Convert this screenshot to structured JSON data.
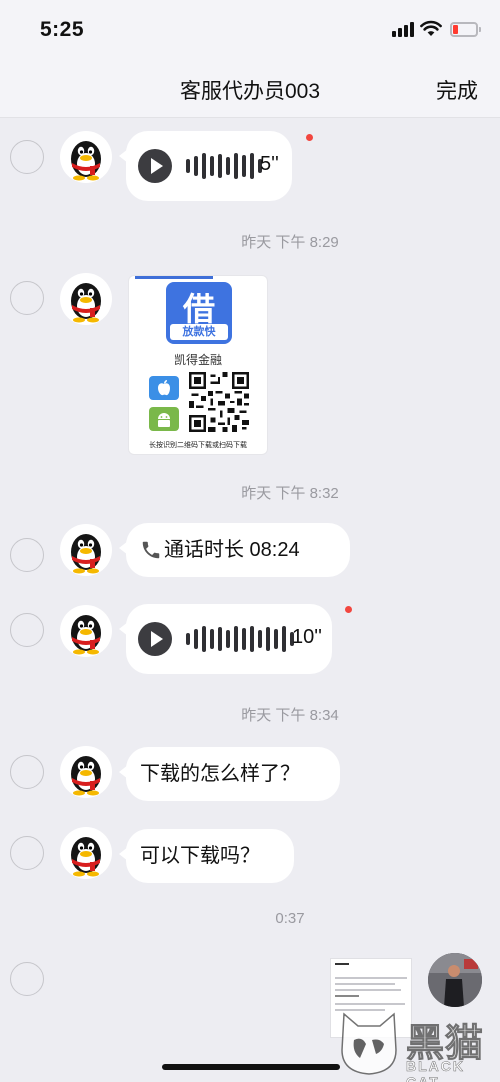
{
  "status_bar": {
    "time": "5:25"
  },
  "nav": {
    "title": "客服代办员003",
    "done_label": "完成"
  },
  "messages": [
    {
      "type": "voice",
      "duration": "5''",
      "unread": true
    },
    {
      "type": "timestamp",
      "text": "昨天 下午 8:29"
    },
    {
      "type": "image",
      "logo_char": "借",
      "logo_sub": "放款快",
      "brand": "凯得金融",
      "caption": "长按识别二维码下载或扫码下载"
    },
    {
      "type": "timestamp",
      "text": "昨天 下午 8:32"
    },
    {
      "type": "call",
      "text": "通话时长 08:24"
    },
    {
      "type": "voice",
      "duration": "10''",
      "unread": true
    },
    {
      "type": "timestamp",
      "text": "昨天 下午 8:34"
    },
    {
      "type": "text",
      "text": "下载的怎么样了？"
    },
    {
      "type": "text",
      "text": "可以下载吗？"
    },
    {
      "type": "timestamp",
      "text": "0:37"
    },
    {
      "type": "image_sent"
    }
  ],
  "watermark": {
    "cn": "黑猫",
    "en": "BLACK CAT"
  },
  "colors": {
    "accent_blue": "#3e73e0",
    "unread_red": "#f2463f",
    "bubble": "#ffffff",
    "background": "#ededf2"
  },
  "icons": [
    "play-icon",
    "phone-icon",
    "apple-icon",
    "android-icon",
    "qr-code-icon",
    "penguin-avatar-icon"
  ]
}
